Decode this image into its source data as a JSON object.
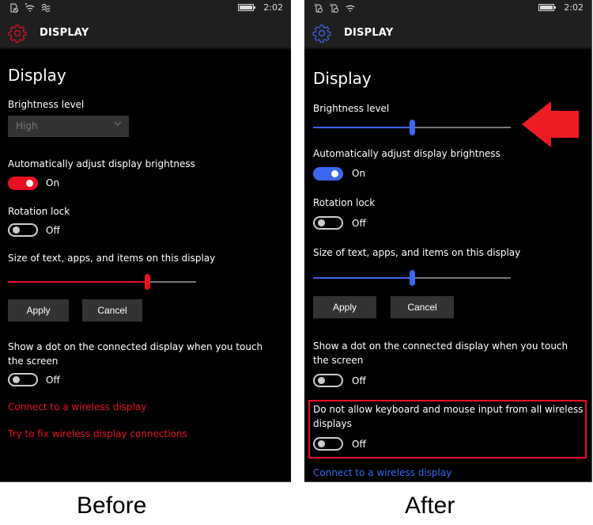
{
  "colors": {
    "before_accent": "#e81123",
    "after_accent": "#3a66f0",
    "annotation_red": "#ed1c24"
  },
  "before": {
    "statusbar": {
      "icons": [
        "sim-no-service-icon",
        "wifi-icon",
        "vibrate-icon"
      ],
      "battery": "charging-battery-icon",
      "time": "2:02"
    },
    "header": {
      "icon": "gear-icon",
      "title": "DISPLAY"
    },
    "page_title": "Display",
    "brightness": {
      "label": "Brightness level",
      "dropdown_value": "High"
    },
    "auto_brightness": {
      "label": "Automatically adjust display brightness",
      "state": "On"
    },
    "rotation_lock": {
      "label": "Rotation lock",
      "state": "Off"
    },
    "text_size": {
      "label": "Size of text, apps, and items on this display",
      "slider_fraction": 0.74
    },
    "buttons": {
      "apply": "Apply",
      "cancel": "Cancel"
    },
    "touch_dot": {
      "label": "Show a dot on the connected display when you touch the screen",
      "state": "Off"
    },
    "links": {
      "connect": "Connect to a wireless display",
      "fix": "Try to fix wireless display connections"
    },
    "caption": "Before"
  },
  "after": {
    "statusbar": {
      "icons": [
        "sim1-no-service-icon",
        "sim2-no-service-icon",
        "wifi-icon"
      ],
      "battery": "battery-icon",
      "time": "2:02"
    },
    "header": {
      "icon": "gear-icon",
      "title": "DISPLAY"
    },
    "page_title": "Display",
    "brightness": {
      "label": "Brightness level",
      "slider_fraction": 0.5
    },
    "auto_brightness": {
      "label": "Automatically adjust display brightness",
      "state": "On"
    },
    "rotation_lock": {
      "label": "Rotation lock",
      "state": "Off"
    },
    "text_size": {
      "label": "Size of text, apps, and items on this display",
      "slider_fraction": 0.5
    },
    "buttons": {
      "apply": "Apply",
      "cancel": "Cancel"
    },
    "touch_dot": {
      "label": "Show a dot on the connected display when you touch the screen",
      "state": "Off"
    },
    "no_input": {
      "label": "Do not allow keyboard and mouse input from all wireless displays",
      "state": "Off"
    },
    "links": {
      "connect": "Connect to a wireless display"
    },
    "caption": "After"
  }
}
